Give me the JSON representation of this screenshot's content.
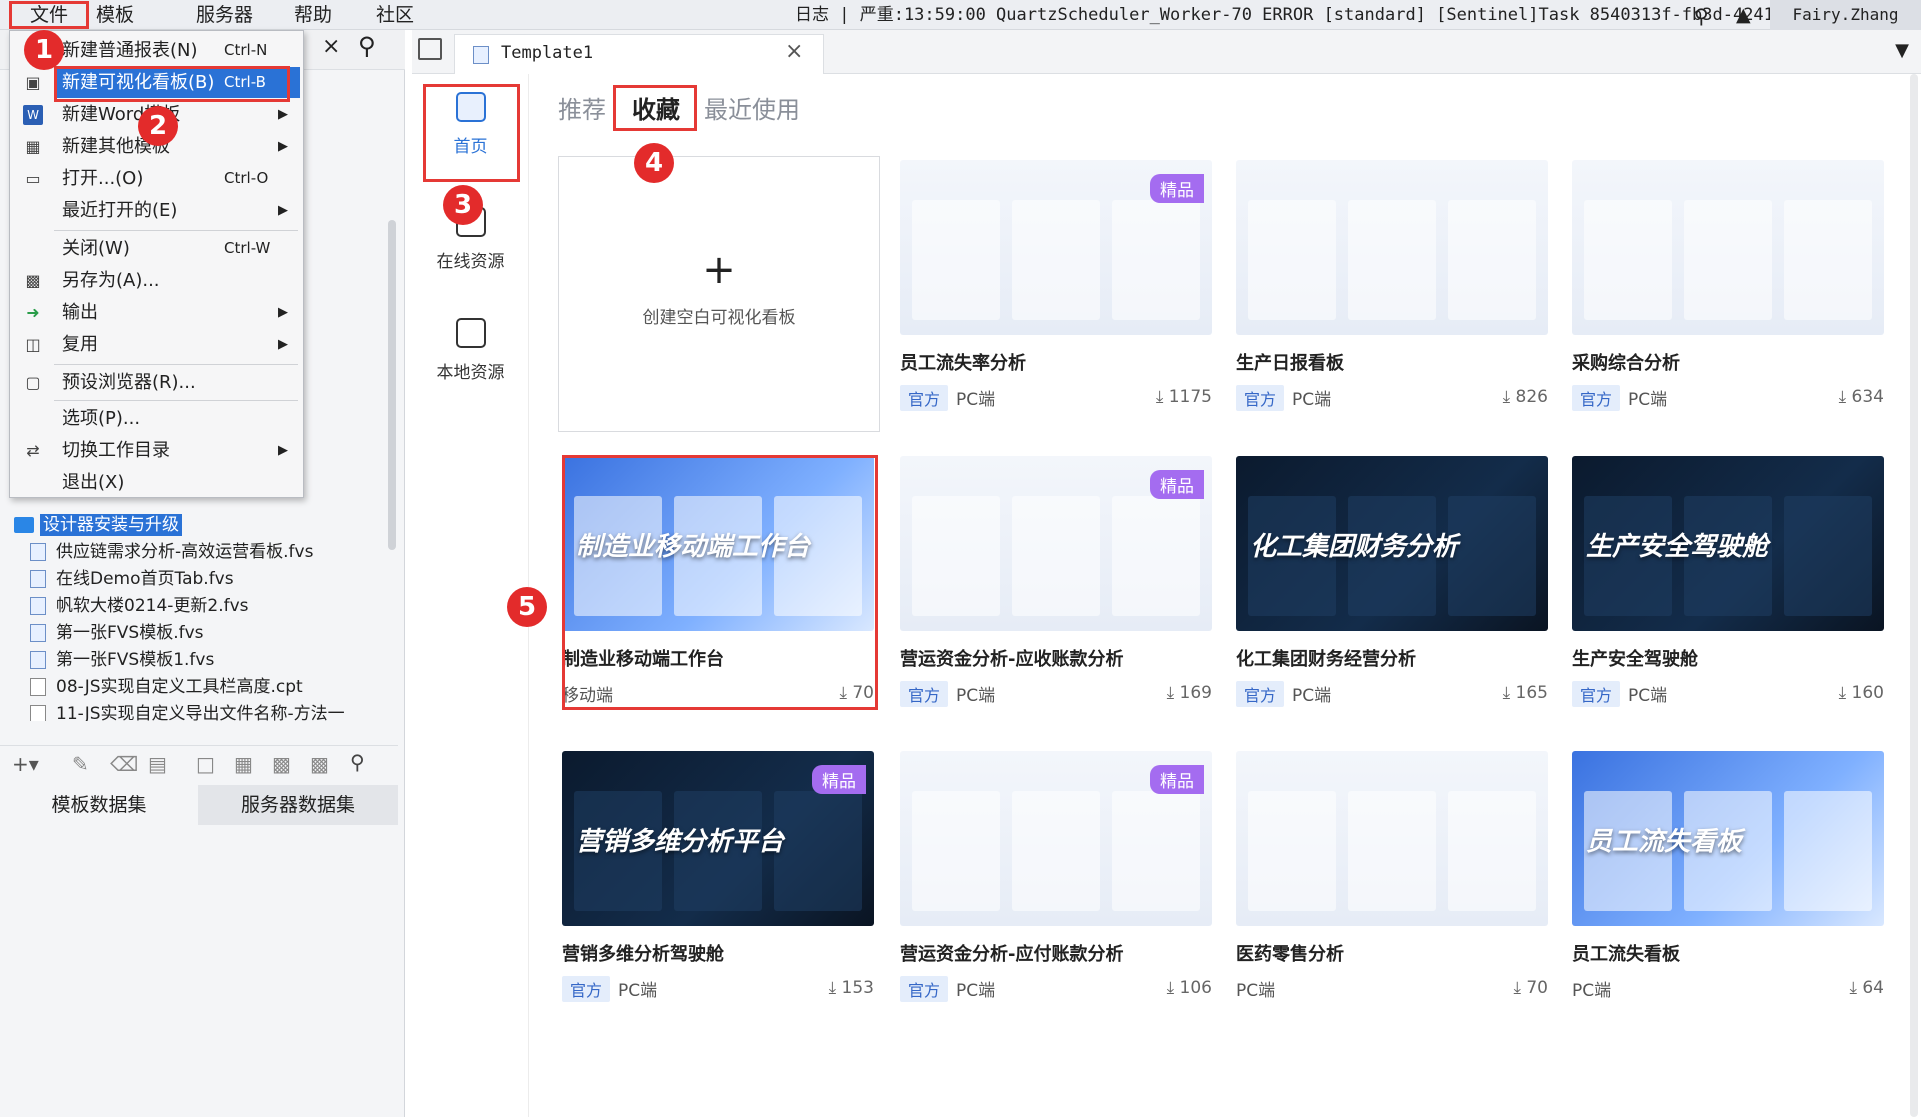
{
  "menubar": {
    "items": [
      "文件",
      "模板",
      "服务器",
      "帮助",
      "社区"
    ],
    "log": "日志 | 严重:13:59:00 QuartzScheduler_Worker-70 ERROR [standard] [Sentinel]Task 8540313f-fb3d-4241...",
    "user": "Fairy.Zhang"
  },
  "filemenu": {
    "items": [
      {
        "icon": "new-report-icon",
        "label": "新建普通报表(N)",
        "shortcut": "Ctrl-N"
      },
      {
        "icon": "new-dashboard-icon",
        "label": "新建可视化看板(B)",
        "shortcut": "Ctrl-B"
      },
      {
        "icon": "word-icon",
        "label": "新建Word模板",
        "arrow": "▶"
      },
      {
        "icon": "template-icon",
        "label": "新建其他模板",
        "arrow": "▶"
      },
      {
        "icon": "folder-open-icon",
        "label": "打开...(O)",
        "shortcut": "Ctrl-O"
      },
      {
        "icon": "",
        "label": "最近打开的(E)",
        "arrow": "▶"
      },
      {
        "icon": "",
        "label": "关闭(W)",
        "shortcut": "Ctrl-W"
      },
      {
        "icon": "save-as-icon",
        "label": "另存为(A)..."
      },
      {
        "icon": "export-icon",
        "label": "输出",
        "arrow": "▶"
      },
      {
        "icon": "reuse-icon",
        "label": "复用",
        "arrow": "▶"
      },
      {
        "icon": "browser-icon",
        "label": "预设浏览器(R)..."
      },
      {
        "icon": "",
        "label": "选项(P)..."
      },
      {
        "icon": "switch-icon",
        "label": "切换工作目录",
        "arrow": "▶"
      },
      {
        "icon": "",
        "label": "退出(X)"
      }
    ]
  },
  "filetree": {
    "folder": "设计器安装与升级",
    "files": [
      "供应链需求分析-高效运营看板.fvs",
      "在线Demo首页Tab.fvs",
      "帆软大楼0214-更新2.fvs",
      "第一张FVS模板.fvs",
      "第一张FVS模板1.fvs",
      "08-JS实现自定义工具栏高度.cpt",
      "11-JS实现自定义导出文件名称-方法一"
    ]
  },
  "dataset_tabs": [
    "模板数据集",
    "服务器数据集"
  ],
  "tab": {
    "title": "Template1",
    "close": "×"
  },
  "nav": {
    "items": [
      "首页",
      "在线资源",
      "本地资源"
    ]
  },
  "content_tabs": [
    "推荐",
    "收藏",
    "最近使用"
  ],
  "create_card": {
    "plus": "+",
    "label": "创建空白可视化看板"
  },
  "cards": [
    {
      "title": "员工流失率分析",
      "badge": "官方",
      "platform": "PC端",
      "downloads": "1175",
      "premium": "精品",
      "theme": "light"
    },
    {
      "title": "生产日报看板",
      "badge": "官方",
      "platform": "PC端",
      "downloads": "826",
      "theme": "light"
    },
    {
      "title": "采购综合分析",
      "badge": "官方",
      "platform": "PC端",
      "downloads": "634",
      "theme": "light"
    },
    {
      "title": "制造业移动端工作台",
      "badge": "",
      "platform": "移动端",
      "downloads": "70",
      "thumb_text": "制造业移动端工作台",
      "theme": "blue"
    },
    {
      "title": "营运资金分析-应收账款分析",
      "badge": "官方",
      "platform": "PC端",
      "downloads": "169",
      "premium": "精品",
      "theme": "light"
    },
    {
      "title": "化工集团财务经营分析",
      "badge": "官方",
      "platform": "PC端",
      "downloads": "165",
      "thumb_text": "化工集团财务分析",
      "theme": "dark"
    },
    {
      "title": "生产安全驾驶舱",
      "badge": "官方",
      "platform": "PC端",
      "downloads": "160",
      "thumb_text": "生产安全驾驶舱",
      "theme": "dark"
    },
    {
      "title": "营销多维分析驾驶舱",
      "badge": "官方",
      "platform": "PC端",
      "downloads": "153",
      "premium": "精品",
      "thumb_text": "营销多维分析平台",
      "theme": "dark"
    },
    {
      "title": "营运资金分析-应付账款分析",
      "badge": "官方",
      "platform": "PC端",
      "downloads": "106",
      "premium": "精品",
      "theme": "light"
    },
    {
      "title": "医药零售分析",
      "badge": "",
      "platform": "PC端",
      "downloads": "70",
      "theme": "light"
    },
    {
      "title": "员工流失看板",
      "badge": "",
      "platform": "PC端",
      "downloads": "64",
      "thumb_text": "员工流失看板",
      "theme": "blue"
    }
  ],
  "annotations": [
    "1",
    "2",
    "3",
    "4",
    "5"
  ],
  "colors": {
    "accent": "#2a72d6",
    "highlight_red": "#e53935",
    "badge_bg": "#e4edfb",
    "premium": "#a46cf0"
  }
}
